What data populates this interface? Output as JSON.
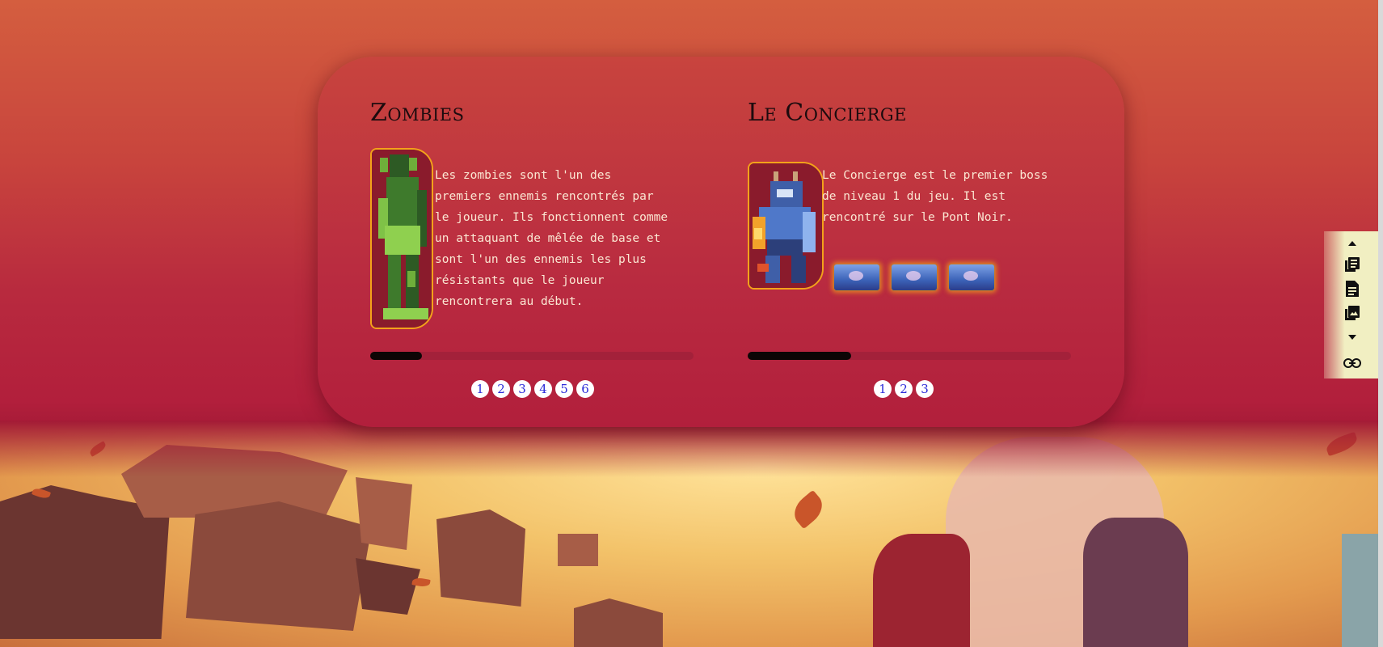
{
  "cards": [
    {
      "title": "Zombies",
      "description": "Les zombies sont l'un des premiers ennemis rencontrés par le joueur. Ils fonctionnent comme un attaquant de mêlée de base et sont l'un des ennemis les plus résistants que le joueur rencontrera au début.",
      "progress": 0.16,
      "pages": [
        "1",
        "2",
        "3",
        "4",
        "5",
        "6"
      ]
    },
    {
      "title": "Le Concierge",
      "description": "Le Concierge est le premier boss de niveau 1 du jeu. Il est rencontré sur le Pont Noir.",
      "progress": 0.32,
      "pages": [
        "1",
        "2",
        "3"
      ],
      "thumbnails": [
        "boss-thumbnail",
        "boss-thumbnail",
        "boss-thumbnail"
      ]
    }
  ],
  "sidebar": {
    "items": [
      "caret-up-icon",
      "articles-icon",
      "document-icon",
      "gallery-icon",
      "caret-down-icon",
      "link-icon"
    ]
  },
  "colors": {
    "panel": "#b92b40",
    "accent_border": "#f3a21a",
    "dot_text": "#2b2bd9",
    "progress_fill": "#0d0505"
  }
}
